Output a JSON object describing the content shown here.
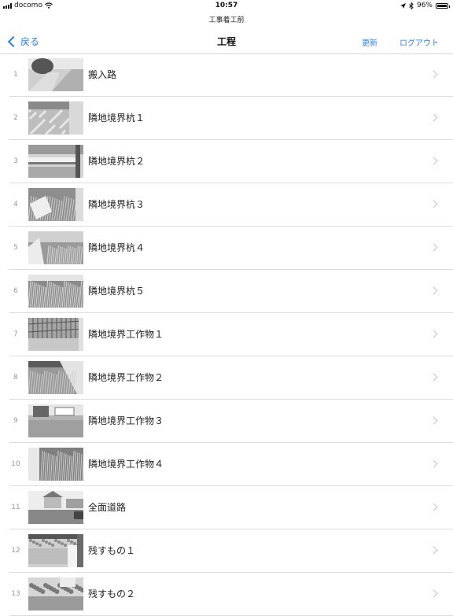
{
  "status": {
    "carrier": "docomo",
    "time": "10:57",
    "battery": "96%",
    "battery_level": 0.96
  },
  "header": {
    "subtitle": "工事着工前",
    "back_label": "戻る",
    "title": "工程",
    "update_label": "更新",
    "logout_label": "ログアウト"
  },
  "items": [
    {
      "num": "1",
      "label": "搬入路"
    },
    {
      "num": "2",
      "label": "隣地境界杭１"
    },
    {
      "num": "3",
      "label": "隣地境界杭２"
    },
    {
      "num": "4",
      "label": "隣地境界杭３"
    },
    {
      "num": "5",
      "label": "隣地境界杭４"
    },
    {
      "num": "6",
      "label": "隣地境界杭５"
    },
    {
      "num": "7",
      "label": "隣地境界工作物１"
    },
    {
      "num": "8",
      "label": "隣地境界工作物２"
    },
    {
      "num": "9",
      "label": "隣地境界工作物３"
    },
    {
      "num": "10",
      "label": "隣地境界工作物４"
    },
    {
      "num": "11",
      "label": "全面道路"
    },
    {
      "num": "12",
      "label": "残すもの１"
    },
    {
      "num": "13",
      "label": "残すもの２"
    }
  ]
}
